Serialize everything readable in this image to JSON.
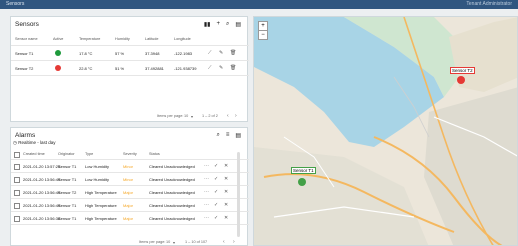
{
  "header": {
    "title": "Sensors",
    "user": "Tenant Administrator"
  },
  "sensors_panel": {
    "title": "Sensors",
    "columns": [
      "Sensor name",
      "Active",
      "Temperature",
      "Humidity",
      "Latitude",
      "Longitude"
    ],
    "rows": [
      {
        "name": "Sensor T1",
        "active": "green",
        "temperature": "17.8 °C",
        "humidity": "57 %",
        "latitude": "37.3948",
        "longitude": "-122.1983"
      },
      {
        "name": "Sensor T2",
        "active": "red",
        "temperature": "22.8 °C",
        "humidity": "51 %",
        "latitude": "37.492881",
        "longitude": "-121.938739"
      }
    ],
    "pager": {
      "items_label": "Items per page:",
      "page_size": "10",
      "range": "1 – 2 of 2"
    }
  },
  "alarms_panel": {
    "title": "Alarms",
    "filter": "Realtime - last day",
    "columns": [
      "Created time",
      "Originator",
      "Type",
      "Severity",
      "Status"
    ],
    "rows": [
      {
        "time": "2021-01-20 13:57:25",
        "originator": "Sensor T1",
        "type": "Low Humidity",
        "severity": "Minor",
        "status": "Cleared Unacknowledged"
      },
      {
        "time": "2021-01-20 13:56:49",
        "originator": "Sensor T1",
        "type": "Low Humidity",
        "severity": "Minor",
        "status": "Cleared Unacknowledged"
      },
      {
        "time": "2021-01-20 13:56:49",
        "originator": "Sensor T2",
        "type": "High Temperature",
        "severity": "Major",
        "status": "Cleared Unacknowledged"
      },
      {
        "time": "2021-01-20 13:56:49",
        "originator": "Sensor T1",
        "type": "High Temperature",
        "severity": "Major",
        "status": "Cleared Unacknowledged"
      },
      {
        "time": "2021-01-20 13:56:38",
        "originator": "Sensor T1",
        "type": "High Temperature",
        "severity": "Major",
        "status": "Cleared Unacknowledged"
      }
    ],
    "pager": {
      "items_label": "Items per page:",
      "page_size": "10",
      "range": "1 – 10 of 107"
    }
  },
  "map": {
    "zoom_in": "+",
    "zoom_out": "−",
    "markers": [
      {
        "label": "Sensor T2",
        "color": "#e53935"
      },
      {
        "label": "Sensor T1",
        "color": "#43a047"
      }
    ]
  }
}
